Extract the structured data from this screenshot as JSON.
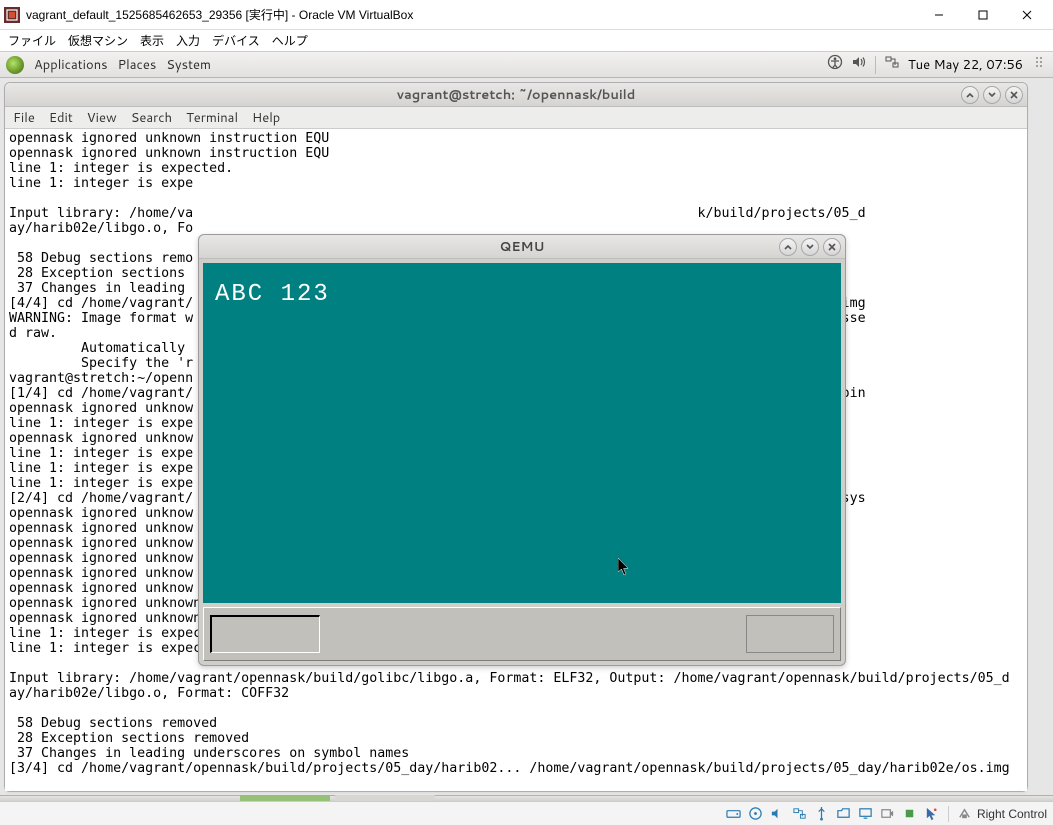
{
  "virtualbox": {
    "title": "vagrant_default_1525685462653_29356 [実行中] - Oracle VM VirtualBox",
    "menu": [
      "ファイル",
      "仮想マシン",
      "表示",
      "入力",
      "デバイス",
      "ヘルプ"
    ],
    "host_key": "Right Control"
  },
  "gnome": {
    "menus": [
      "Applications",
      "Places",
      "System"
    ],
    "clock": "Tue May 22, 07:56"
  },
  "terminal": {
    "title": "vagrant@stretch: ~/opennask/build",
    "menu": [
      "File",
      "Edit",
      "View",
      "Search",
      "Terminal",
      "Help"
    ],
    "content": "opennask ignored unknown instruction EQU\nopennask ignored unknown instruction EQU\nline 1: integer is expected.\nline 1: integer is expe\n\nInput library: /home/va                                                               k/build/projects/05_d\nay/harib02e/libgo.o, Fo\n\n 58 Debug sections remo\n 28 Exception sections \n 37 Changes in leading \n[4/4] cd /home/vagrant/                                                               5_day/harib02e/os.img\nWARNING: Image format w                                                               g' and probing guesse\nd raw.\n         Automatically                                                                l be restricted.\n         Specify the 'r\nvagrant@stretch:~/openn\n[1/4] cd /home/vagrant/                                                               _day/harib02e/ipl.bin\nopennask ignored unknow\nline 1: integer is expe\nopennask ignored unknow\nline 1: integer is expe\nline 1: integer is expe\nline 1: integer is expe\n[2/4] cd /home/vagrant/                                                               5_day/harib02e/os.sys\nopennask ignored unknow\nopennask ignored unknow\nopennask ignored unknow\nopennask ignored unknow\nopennask ignored unknow\nopennask ignored unknow\nopennask ignored unknown instruction EQU\nopennask ignored unknown instruction EQU\nline 1: integer is expected.\nline 1: integer is expected.\n\nInput library: /home/vagrant/opennask/build/golibc/libgo.a, Format: ELF32, Output: /home/vagrant/opennask/build/projects/05_d\nay/harib02e/libgo.o, Format: COFF32\n\n 58 Debug sections removed\n 28 Exception sections removed\n 37 Changes in leading underscores on symbol names\n[3/4] cd /home/vagrant/opennask/build/projects/05_day/harib02... /home/vagrant/opennask/build/projects/05_day/harib02e/os.img"
  },
  "qemu": {
    "title": "QEMU",
    "screen_text": "ABC 123"
  }
}
